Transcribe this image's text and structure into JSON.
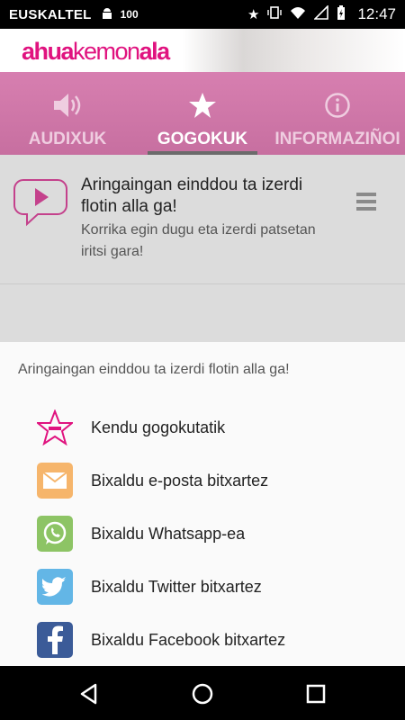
{
  "status_bar": {
    "carrier": "EUSKALTEL",
    "badge": "100",
    "time": "12:47"
  },
  "app": {
    "logo_part1": "ahua",
    "logo_part2": "kemon",
    "logo_part3": "ala"
  },
  "tabs": [
    {
      "label": "AUDIXUK",
      "icon": "speaker-icon",
      "active": false
    },
    {
      "label": "GOGOKUK",
      "icon": "star-icon",
      "active": true
    },
    {
      "label": "INFORMAZIÑOI",
      "icon": "info-icon",
      "active": false
    }
  ],
  "list": {
    "item": {
      "title": "Aringaingan einddou ta izerdi flotin alla ga!",
      "subtitle": "Korrika egin dugu eta izerdi patsetan iritsi gara!"
    }
  },
  "sheet": {
    "title": "Aringaingan einddou ta izerdi flotin alla ga!",
    "options": [
      {
        "label": "Kendu gogokutatik",
        "icon": "star-minus-icon"
      },
      {
        "label": "Bixaldu e-posta bitxartez",
        "icon": "email-icon"
      },
      {
        "label": "Bixaldu Whatsapp-ea",
        "icon": "whatsapp-icon"
      },
      {
        "label": "Bixaldu Twitter bitxartez",
        "icon": "twitter-icon"
      },
      {
        "label": "Bixaldu Facebook bitxartez",
        "icon": "facebook-icon"
      }
    ]
  },
  "colors": {
    "brand": "#e0137f",
    "email": "#f6b56b",
    "whatsapp": "#8dc465",
    "twitter": "#63b6e6",
    "facebook": "#3b5b98"
  }
}
